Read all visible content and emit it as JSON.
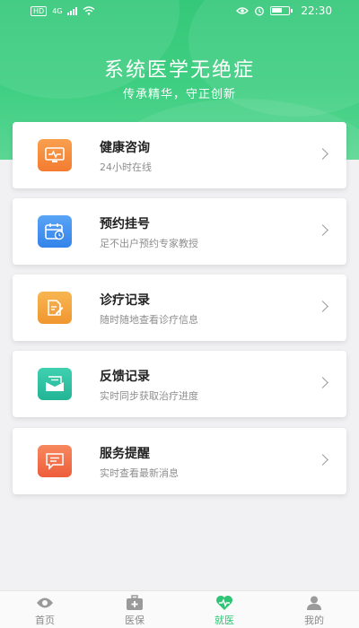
{
  "status_bar": {
    "network": "4G",
    "time": "22:30"
  },
  "header": {
    "title": "系统医学无绝症",
    "subtitle": "传承精华，守正创新"
  },
  "cards": [
    {
      "title": "健康咨询",
      "desc": "24小时在线",
      "icon": "monitor-pulse-icon",
      "color": "#f5893b"
    },
    {
      "title": "预约挂号",
      "desc": "足不出户预约专家教授",
      "icon": "calendar-icon",
      "color": "#3d8ff0"
    },
    {
      "title": "诊疗记录",
      "desc": "随时随地查看诊疗信息",
      "icon": "document-edit-icon",
      "color": "#f3a23f"
    },
    {
      "title": "反馈记录",
      "desc": "实时同步获取治疗进度",
      "icon": "envelope-icon",
      "color": "#2cc1a1"
    },
    {
      "title": "服务提醒",
      "desc": "实时查看最新消息",
      "icon": "message-icon",
      "color": "#f16b45"
    }
  ],
  "tabbar": {
    "active_color": "#2fc476",
    "items": [
      {
        "label": "首页",
        "icon": "eye-home-icon"
      },
      {
        "label": "医保",
        "icon": "medical-kit-icon"
      },
      {
        "label": "就医",
        "icon": "heart-pulse-icon",
        "active": true
      },
      {
        "label": "我的",
        "icon": "user-icon"
      }
    ]
  }
}
